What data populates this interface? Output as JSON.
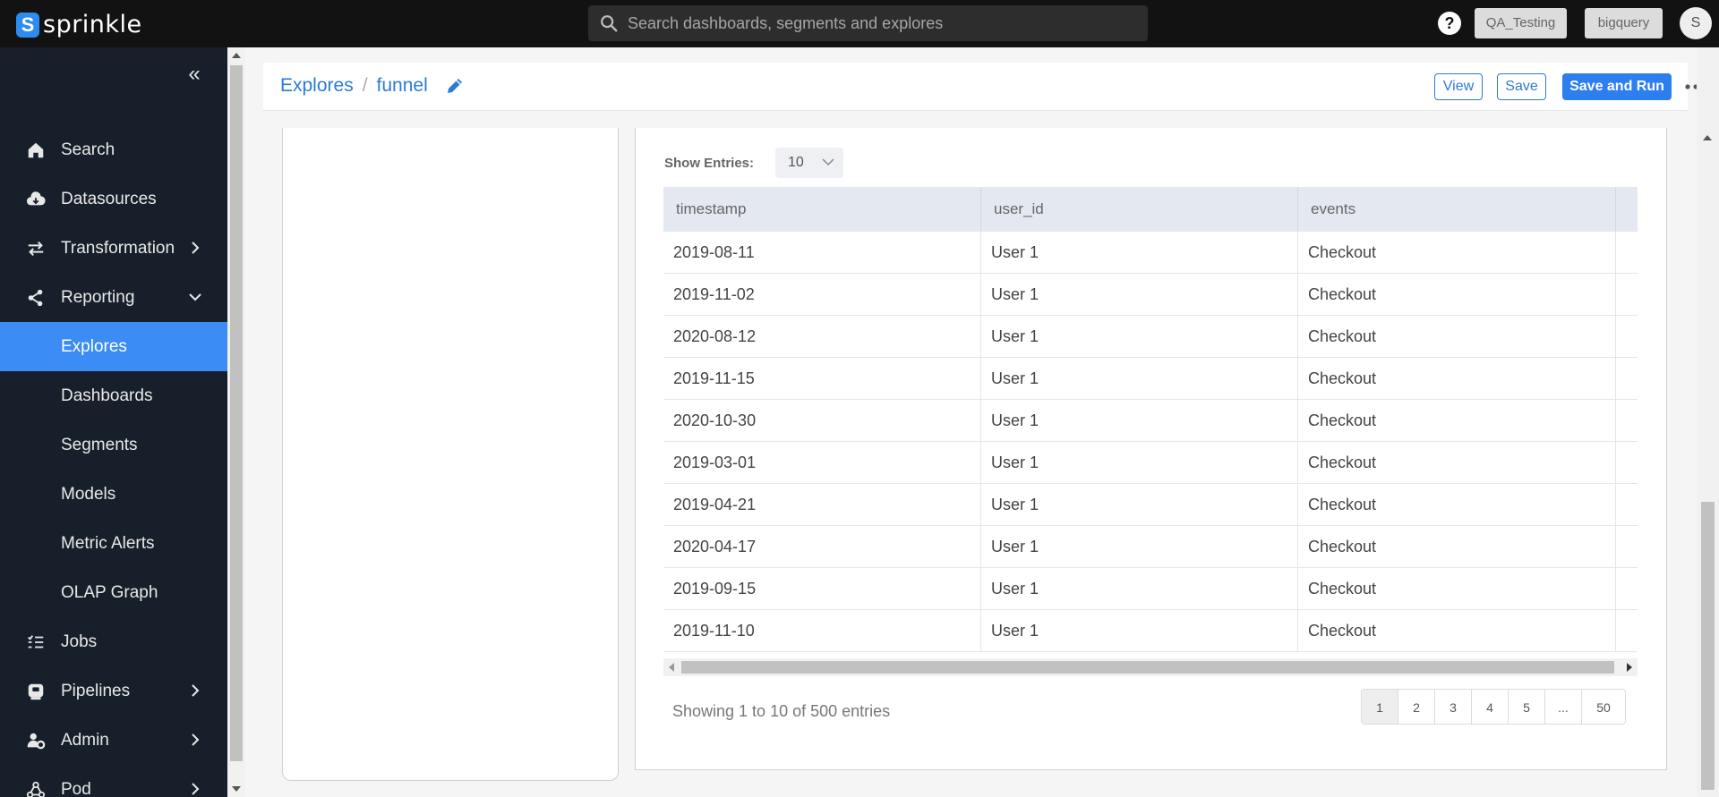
{
  "app": {
    "name": "sprinkle"
  },
  "topbar": {
    "search_placeholder": "Search dashboards, segments and explores",
    "help_label": "?",
    "environment": "QA_Testing",
    "database": "bigquery",
    "avatar_initial": "S"
  },
  "sidebar": {
    "items": [
      {
        "label": "Search",
        "icon": "home-icon"
      },
      {
        "label": "Datasources",
        "icon": "cloud-download-icon"
      },
      {
        "label": "Transformation",
        "icon": "arrows-exchange-icon"
      },
      {
        "label": "Reporting",
        "icon": "share-nodes-icon"
      },
      {
        "label": "Explores"
      },
      {
        "label": "Dashboards"
      },
      {
        "label": "Segments"
      },
      {
        "label": "Models"
      },
      {
        "label": "Metric Alerts"
      },
      {
        "label": "OLAP Graph"
      },
      {
        "label": "Jobs",
        "icon": "list-check-icon"
      },
      {
        "label": "Pipelines",
        "icon": "pipeline-icon"
      },
      {
        "label": "Admin",
        "icon": "admin-gear-icon"
      },
      {
        "label": "Pod",
        "icon": "pod-nodes-icon"
      }
    ],
    "active_item": "Explores"
  },
  "header": {
    "breadcrumb_root": "Explores",
    "breadcrumb_sep": "/",
    "breadcrumb_current": "funnel",
    "view_label": "View",
    "save_label": "Save",
    "save_run_label": "Save and Run"
  },
  "table": {
    "show_entries_label": "Show Entries:",
    "entries_value": "10",
    "columns": [
      "timestamp",
      "user_id",
      "events"
    ],
    "rows": [
      [
        "2019-08-11",
        "User 1",
        "Checkout"
      ],
      [
        "2019-11-02",
        "User 1",
        "Checkout"
      ],
      [
        "2020-08-12",
        "User 1",
        "Checkout"
      ],
      [
        "2019-11-15",
        "User 1",
        "Checkout"
      ],
      [
        "2020-10-30",
        "User 1",
        "Checkout"
      ],
      [
        "2019-03-01",
        "User 1",
        "Checkout"
      ],
      [
        "2019-04-21",
        "User 1",
        "Checkout"
      ],
      [
        "2020-04-17",
        "User 1",
        "Checkout"
      ],
      [
        "2019-09-15",
        "User 1",
        "Checkout"
      ],
      [
        "2019-11-10",
        "User 1",
        "Checkout"
      ]
    ],
    "showing_text": "Showing 1 to 10 of 500 entries",
    "pages": [
      "1",
      "2",
      "3",
      "4",
      "5",
      "...",
      "50"
    ],
    "active_page": "1"
  },
  "colors": {
    "topbar_bg": "#121212",
    "sidebar_bg": "#17202a",
    "active_nav": "#3b8cf4",
    "link": "#2b7bd6",
    "primary_button": "#2d7ff0"
  }
}
